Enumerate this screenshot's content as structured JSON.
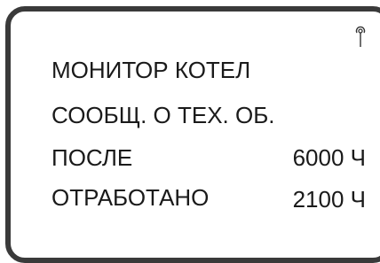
{
  "display": {
    "line1": "МОНИТОР КОТЕЛ",
    "line2": "СООБЩ. О ТЕХ. ОБ.",
    "after_label": "ПОСЛЕ",
    "after_value": "6000 Ч",
    "worked_label": "ОТРАБОТАНО",
    "worked_value": "2100 Ч",
    "status_icon": "antenna-icon"
  }
}
